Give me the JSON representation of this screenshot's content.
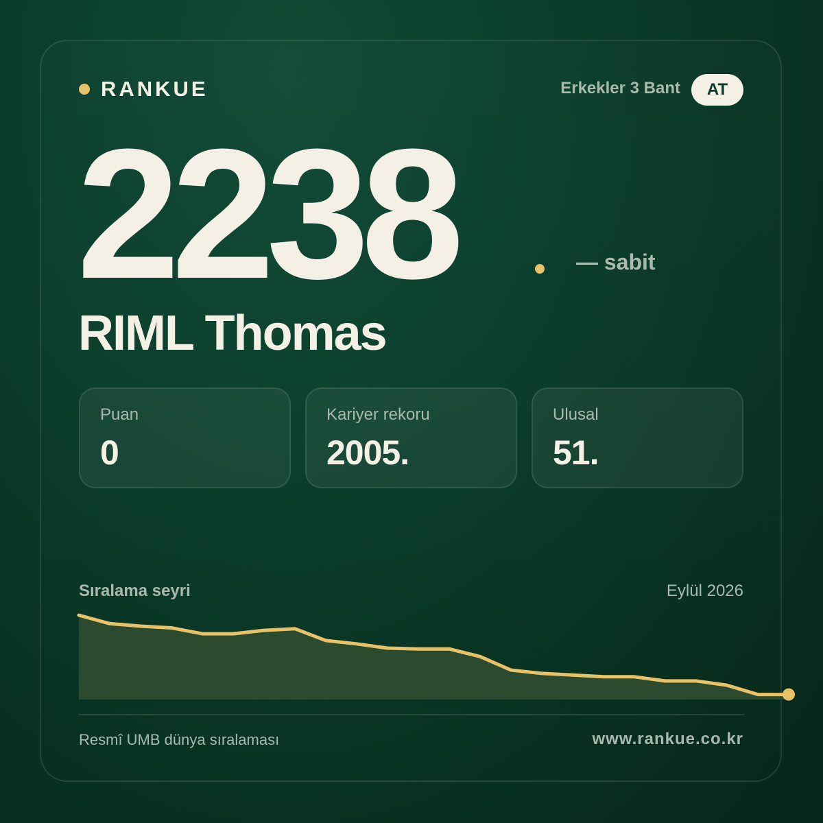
{
  "brand": {
    "name": "RANKUE"
  },
  "header": {
    "category": "Erkekler 3 Bant",
    "country_code": "AT"
  },
  "rank": {
    "value": "2238",
    "trend": "— sabit"
  },
  "player": {
    "name": "RIML Thomas"
  },
  "stats": [
    {
      "label": "Puan",
      "value": "0"
    },
    {
      "label": "Kariyer rekoru",
      "value": "2005."
    },
    {
      "label": "Ulusal",
      "value": "51."
    }
  ],
  "chart": {
    "title": "Sıralama seyri",
    "date": "Eylül 2026"
  },
  "footer": {
    "source": "Resmî UMB dünya sıralaması",
    "website": "www.rankue.co.kr"
  },
  "colors": {
    "accent": "#e8c268",
    "text": "#f5f0e6",
    "muted": "#a9b9ae",
    "background": "#0a3a29",
    "area_fill": "#2c4a2d"
  },
  "icons": {
    "brand_dot": "dot",
    "rank_dot": "dot"
  },
  "chart_data": {
    "type": "area",
    "title": "Sıralama seyri",
    "series": [
      {
        "values": [
          1,
          0.9,
          0.87,
          0.85,
          0.78,
          0.78,
          0.82,
          0.84,
          0.7,
          0.66,
          0.61,
          0.6,
          0.6,
          0.51,
          0.35,
          0.31,
          0.29,
          0.27,
          0.27,
          0.22,
          0.22,
          0.17,
          0.06,
          0.06
        ]
      }
    ],
    "y_scale": "relative",
    "grid": false,
    "legend": "none"
  }
}
